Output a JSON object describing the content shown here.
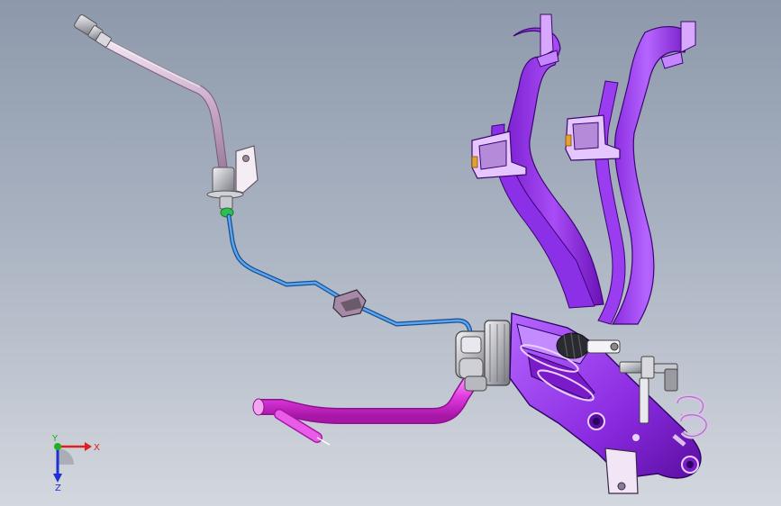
{
  "viewport": {
    "background_top": "#8d99ab",
    "background_bottom": "#d3d7de"
  },
  "colors": {
    "pedal_purple": "#9b2cf0",
    "pedal_dark": "#6a10b8",
    "pedal_light": "#c37bff",
    "hose_magenta": "#e63ce6",
    "brake_line_blue": "#2f7fd6",
    "rubber_hose": "#c9a9c9",
    "metal_grey": "#b4b4bc"
  },
  "triad": {
    "x_label": "X",
    "y_label": "Y",
    "z_label": "Z",
    "x_color": "#e02020",
    "y_color": "#20b020",
    "z_color": "#2030d0"
  }
}
